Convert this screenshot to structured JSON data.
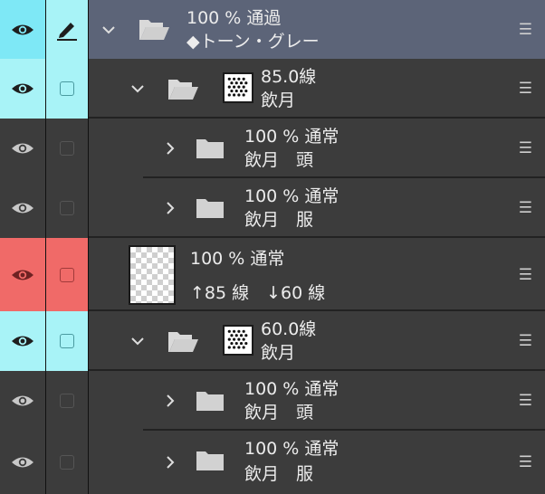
{
  "colors": {
    "panel_bg": "#3c3c3c",
    "selected_row_bg": "#5c6478",
    "cyan_highlight": "#a8f3f7",
    "red_highlight": "#f06a68",
    "bright_cyan_eye": "#7ee8f6"
  },
  "layers": [
    {
      "line1": "100 % 通過",
      "line2": "◆トーン・グレー",
      "icon": "folder-open-icon",
      "expanded": true,
      "selected": true
    },
    {
      "line1": "85.0線",
      "line2": "飲月",
      "icon": "folder-open-icon",
      "expanded": true,
      "thumbnail": "tone-dots-thumbnail"
    },
    {
      "line1": "100 % 通常",
      "line2": "飲月　頭",
      "icon": "folder-closed-icon",
      "expanded": false
    },
    {
      "line1": "100 % 通常",
      "line2": "飲月　服",
      "icon": "folder-closed-icon",
      "expanded": false
    },
    {
      "line1": "100 % 通常",
      "line2": "↑85 線　↓60 線",
      "icon": "transparent-layer-thumbnail"
    },
    {
      "line1": "60.0線",
      "line2": "飲月",
      "icon": "folder-open-icon",
      "expanded": true,
      "thumbnail": "tone-dots-thumbnail"
    },
    {
      "line1": "100 % 通常",
      "line2": "飲月　頭",
      "icon": "folder-closed-icon",
      "expanded": false
    },
    {
      "line1": "100 % 通常",
      "line2": "飲月　服",
      "icon": "folder-closed-icon",
      "expanded": false
    }
  ],
  "menu_glyph": "☰"
}
